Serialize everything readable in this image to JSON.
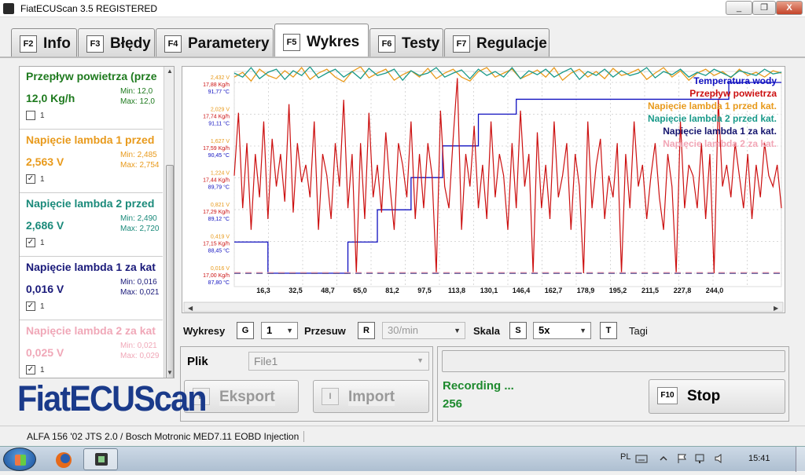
{
  "window": {
    "title": "FiatECUScan 3.5 REGISTERED",
    "min": "_",
    "max": "❐",
    "close": "X"
  },
  "tabs": [
    {
      "key": "F2",
      "label": "Info"
    },
    {
      "key": "F3",
      "label": "Błędy"
    },
    {
      "key": "F4",
      "label": "Parametery"
    },
    {
      "key": "F5",
      "label": "Wykres"
    },
    {
      "key": "F6",
      "label": "Testy"
    },
    {
      "key": "F7",
      "label": "Regulacje"
    }
  ],
  "params": [
    {
      "name": "Przepływ powietrza (prze",
      "value": "12,0 Kg/h",
      "min": "Min: 12,0",
      "max": "Max: 12,0",
      "checked": false,
      "index": "1",
      "color": "#1e7a1e"
    },
    {
      "name": "Napięcie lambda 1 przed",
      "value": "2,563 V",
      "min": "Min: 2,485",
      "max": "Max: 2,754",
      "checked": true,
      "index": "1",
      "color": "#e89a1c"
    },
    {
      "name": "Napięcie lambda 2 przed",
      "value": "2,686 V",
      "min": "Min: 2,490",
      "max": "Max: 2,720",
      "checked": true,
      "index": "1",
      "color": "#1a8a7a"
    },
    {
      "name": "Napięcie lambda 1 za kat",
      "value": "0,016 V",
      "min": "Min: 0,016",
      "max": "Max: 0,021",
      "checked": true,
      "index": "1",
      "color": "#1a1a7a"
    },
    {
      "name": "Napięcie lambda 2 za kat",
      "value": "0,025 V",
      "min": "Min: 0,021",
      "max": "Max: 0,029",
      "checked": true,
      "index": "1",
      "color": "#f0a8b8"
    }
  ],
  "controls": {
    "wykresy_label": "Wykresy",
    "wykresy_key": "G",
    "wykresy_value": "1",
    "przesuw_label": "Przesuw",
    "przesuw_key": "R",
    "przesuw_value": "30/min",
    "skala_label": "Skala",
    "skala_key": "S",
    "skala_value": "5x",
    "tagi_key": "T",
    "tagi_label": "Tagi"
  },
  "file": {
    "label": "Plik",
    "value": "File1",
    "export_key": "E",
    "export_label": "Eksport",
    "import_key": "I",
    "import_label": "Import"
  },
  "recording": {
    "status": "Recording ...",
    "count": "256",
    "stop_key": "F10",
    "stop_label": "Stop"
  },
  "logo": "FiatECUScan",
  "statusbar": "ALFA 156 '02 JTS 2.0 / Bosch Motronic MED7.11 EOBD Injection",
  "taskbar": {
    "lang": "PL",
    "clock": "15:41"
  },
  "chart_data": {
    "type": "line",
    "x_ticks": [
      "16,3",
      "32,5",
      "48,7",
      "65,0",
      "81,2",
      "97,5",
      "113,8",
      "130,1",
      "146,4",
      "162,7",
      "178,9",
      "195,2",
      "211,5",
      "227,8",
      "244,0"
    ],
    "y_tick_groups": [
      {
        "lambda": "2,432 V",
        "flow": "17,88 Kg/h",
        "temp": "91,77 °C"
      },
      {
        "lambda": "2,029 V",
        "flow": "17,74 Kg/h",
        "temp": "91,11 °C"
      },
      {
        "lambda": "1,627 V",
        "flow": "17,59 Kg/h",
        "temp": "90,45 °C"
      },
      {
        "lambda": "1,224 V",
        "flow": "17,44 Kg/h",
        "temp": "89,79 °C"
      },
      {
        "lambda": "0,821 V",
        "flow": "17,29 Kg/h",
        "temp": "89,12 °C"
      },
      {
        "lambda": "0,419 V",
        "flow": "17,15 Kg/h",
        "temp": "88,45 °C"
      },
      {
        "lambda": "0,016 V",
        "flow": "17,00 Kg/h",
        "temp": "87,80 °C"
      }
    ],
    "grid": true,
    "legend_position": "top-right",
    "series": [
      {
        "name": "Temperatura wody",
        "color": "#1010c0",
        "x": [
          0,
          16,
          37,
          47,
          54,
          62,
          68,
          71,
          84,
          90,
          97,
          99,
          115,
          116,
          130,
          134,
          190,
          232,
          235,
          260
        ],
        "y": [
          88.45,
          87.8,
          87.8,
          87.8,
          88.45,
          88.45,
          89.12,
          89.12,
          89.79,
          89.79,
          89.79,
          90.45,
          90.45,
          91.11,
          91.11,
          91.42,
          91.42,
          91.42,
          91.77,
          91.77
        ]
      },
      {
        "name": "Przepływ powietrza",
        "color": "#cc1010",
        "x": [
          0,
          2,
          4,
          6,
          8,
          10,
          12,
          14,
          16,
          18,
          20,
          22,
          24,
          26,
          28,
          30,
          32,
          34,
          36,
          38,
          40,
          42,
          44,
          46,
          48,
          50,
          52,
          54,
          56,
          58,
          60,
          62,
          64,
          66,
          68,
          70,
          72,
          74,
          76,
          78,
          80,
          82,
          84,
          86,
          88,
          90,
          92,
          94,
          96,
          98,
          100,
          102,
          104,
          106,
          108,
          110,
          112,
          114,
          116,
          118,
          120,
          122,
          124,
          126,
          128,
          130,
          132,
          134,
          136,
          138,
          140,
          142,
          144,
          146,
          148,
          150,
          152,
          154,
          156,
          158,
          160,
          162,
          164,
          166,
          168,
          170,
          172,
          174,
          176,
          178,
          180,
          182,
          184,
          186,
          188,
          190,
          192,
          194,
          196,
          198,
          200,
          202,
          204,
          206,
          208,
          210,
          212,
          214,
          216,
          218,
          220,
          222,
          224,
          226,
          228,
          230,
          232,
          234,
          236,
          238,
          240,
          242,
          244,
          246,
          248,
          250,
          252,
          254,
          256,
          258,
          260
        ],
        "y": [
          17.45,
          17.74,
          17.3,
          17.6,
          17.2,
          17.55,
          17.35,
          17.7,
          17.25,
          17.62,
          17.4,
          17.55,
          17.33,
          17.78,
          17.28,
          17.6,
          17.42,
          17.5,
          17.35,
          17.7,
          17.2,
          17.55,
          17.45,
          17.25,
          17.6,
          17.4,
          17.8,
          17.3,
          17.55,
          17.0,
          17.6,
          17.25,
          17.74,
          17.35,
          17.5,
          17.28,
          17.65,
          17.4,
          17.2,
          17.6,
          17.5,
          17.35,
          17.7,
          17.25,
          17.55,
          17.3,
          17.6,
          17.45,
          17.0,
          17.75,
          17.4,
          17.3,
          17.62,
          17.9,
          17.2,
          17.55,
          17.4,
          17.68,
          17.3,
          17.5,
          17.25,
          17.7,
          17.35,
          17.55,
          17.45,
          17.2,
          17.6,
          17.3,
          17.75,
          17.4,
          17.55,
          17.0,
          17.65,
          17.3,
          17.5,
          17.25,
          17.7,
          17.35,
          17.45,
          17.6,
          17.2,
          17.55,
          17.4,
          17.0,
          17.7,
          17.3,
          17.5,
          17.62,
          17.25,
          17.45,
          17.35,
          17.6,
          17.0,
          17.55,
          17.3,
          17.7,
          17.4,
          17.5,
          17.25,
          17.45,
          17.6,
          17.35,
          17.2,
          17.55,
          17.4,
          17.0,
          17.7,
          17.3,
          17.5,
          17.45,
          17.3,
          17.6,
          17.25,
          17.55,
          17.0,
          17.8,
          17.4,
          17.5,
          17.35,
          17.6,
          17.45,
          17.3,
          17.55,
          17.25,
          17.5,
          17.35,
          17.6,
          17.45,
          17.4,
          17.5,
          17.3
        ]
      },
      {
        "name": "Napięcie lambda 1 przed kat.",
        "color": "#e89a1c",
        "x": [
          0,
          4,
          8,
          12,
          16,
          20,
          24,
          28,
          32,
          36,
          40,
          44,
          48,
          52,
          56,
          60,
          64,
          68,
          72,
          76,
          80,
          84,
          88,
          92,
          96,
          100,
          104,
          108,
          112,
          116,
          120,
          124,
          128,
          132,
          136,
          140,
          144,
          148,
          152,
          156,
          160,
          164,
          168,
          172,
          176,
          180,
          184,
          188,
          192,
          196,
          200,
          204,
          208,
          212,
          216,
          220,
          224,
          228,
          232,
          236,
          240,
          244,
          248,
          252,
          256,
          260
        ],
        "y": [
          2.5,
          2.56,
          2.45,
          2.6,
          2.52,
          2.48,
          2.58,
          2.5,
          2.62,
          2.47,
          2.55,
          2.6,
          2.5,
          2.44,
          2.57,
          2.63,
          2.49,
          2.55,
          2.6,
          2.46,
          2.53,
          2.58,
          2.5,
          2.61,
          2.48,
          2.55,
          2.6,
          2.5,
          2.45,
          2.57,
          2.62,
          2.5,
          2.55,
          2.6,
          2.48,
          2.53,
          2.59,
          2.5,
          2.62,
          2.46,
          2.55,
          2.6,
          2.5,
          2.57,
          2.48,
          2.61,
          2.52,
          2.55,
          2.6,
          2.47,
          2.55,
          2.62,
          2.5,
          2.58,
          2.46,
          2.55,
          2.6,
          2.52,
          2.57,
          2.49,
          2.6,
          2.52,
          2.56,
          2.5,
          2.58,
          2.55
        ]
      },
      {
        "name": "Napięcie lambda 2 przed kat.",
        "color": "#1a9a8a",
        "x": [
          0,
          4,
          8,
          12,
          16,
          20,
          24,
          28,
          32,
          36,
          40,
          44,
          48,
          52,
          56,
          60,
          64,
          68,
          72,
          76,
          80,
          84,
          88,
          92,
          96,
          100,
          104,
          108,
          112,
          116,
          120,
          124,
          128,
          132,
          136,
          140,
          144,
          148,
          152,
          156,
          160,
          164,
          168,
          172,
          176,
          180,
          184,
          188,
          192,
          196,
          200,
          204,
          208,
          212,
          216,
          220,
          224,
          228,
          232,
          236,
          240,
          244,
          248,
          252,
          256,
          260
        ],
        "y": [
          2.55,
          2.5,
          2.62,
          2.48,
          2.56,
          2.6,
          2.47,
          2.58,
          2.52,
          2.63,
          2.49,
          2.55,
          2.6,
          2.5,
          2.57,
          2.48,
          2.61,
          2.52,
          2.55,
          2.6,
          2.46,
          2.58,
          2.52,
          2.55,
          2.62,
          2.5,
          2.55,
          2.59,
          2.48,
          2.6,
          2.52,
          2.57,
          2.5,
          2.62,
          2.48,
          2.58,
          2.53,
          2.6,
          2.5,
          2.56,
          2.61,
          2.47,
          2.57,
          2.52,
          2.6,
          2.5,
          2.58,
          2.52,
          2.55,
          2.62,
          2.49,
          2.57,
          2.53,
          2.6,
          2.5,
          2.56,
          2.52,
          2.6,
          2.55,
          2.5,
          2.58,
          2.55,
          2.52,
          2.6,
          2.54,
          2.56
        ]
      },
      {
        "name": "Napięcie lambda 1 za kat.",
        "color": "#14146e",
        "x": [
          0,
          260
        ],
        "y": [
          0.016,
          0.016
        ]
      },
      {
        "name": "Napięcie lambda 2 za kat.",
        "color": "#f2a6b6",
        "x": [
          0,
          260
        ],
        "y": [
          0.025,
          0.025
        ]
      }
    ]
  }
}
